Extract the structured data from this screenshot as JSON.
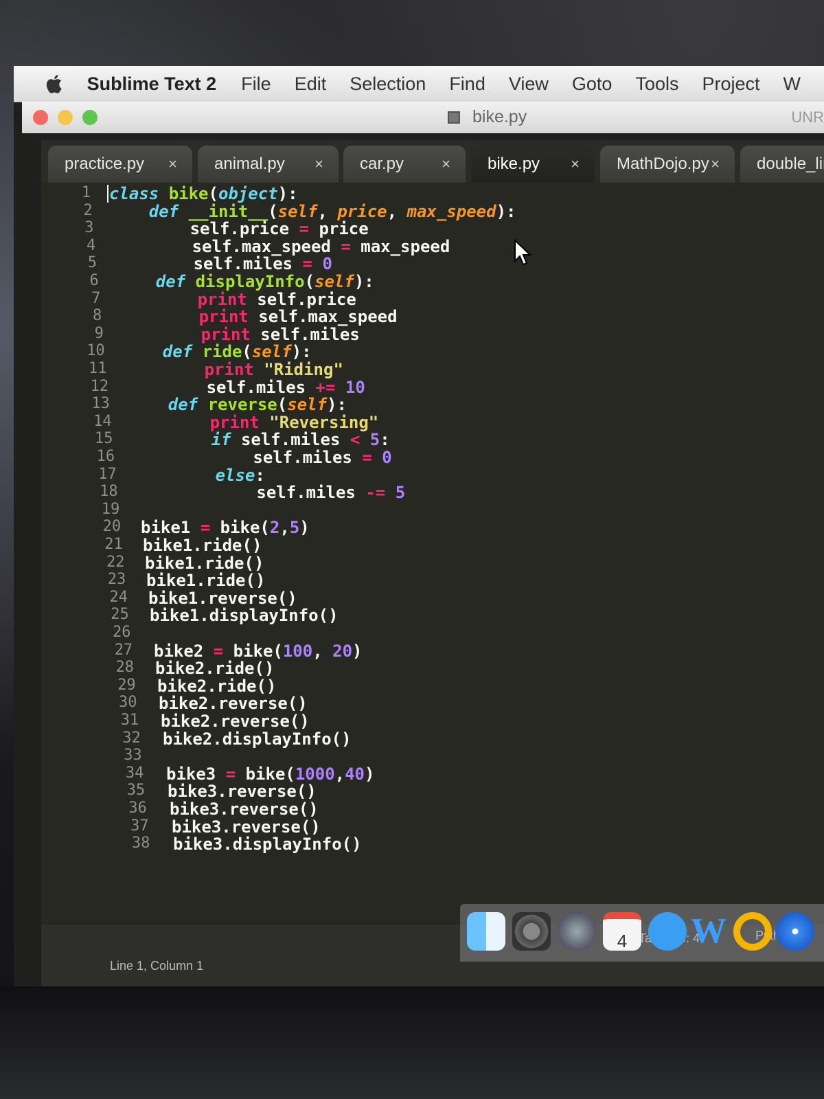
{
  "menubar": {
    "app_name": "Sublime Text 2",
    "items": [
      "File",
      "Edit",
      "Selection",
      "Find",
      "View",
      "Goto",
      "Tools",
      "Project",
      "W"
    ]
  },
  "window": {
    "title": "bike.py",
    "right_label": "UNR"
  },
  "tabs": [
    {
      "label": "practice.py",
      "active": false
    },
    {
      "label": "animal.py",
      "active": false
    },
    {
      "label": "car.py",
      "active": false
    },
    {
      "label": "bike.py",
      "active": true
    },
    {
      "label": "MathDojo.py",
      "active": false
    },
    {
      "label": "double_lin",
      "active": false
    }
  ],
  "tab_close_glyph": "×",
  "code": {
    "line_numbers": [
      "1",
      "2",
      "3",
      "4",
      "5",
      "6",
      "7",
      "8",
      "9",
      "10",
      "11",
      "12",
      "13",
      "14",
      "15",
      "16",
      "17",
      "18",
      "19",
      "20",
      "21",
      "22",
      "23",
      "24",
      "25",
      "26",
      "27",
      "28",
      "29",
      "30",
      "31",
      "32",
      "33",
      "34",
      "35",
      "36",
      "37",
      "38"
    ],
    "lines": [
      "class bike(object):",
      "    def __init__(self, price, max_speed):",
      "        self.price = price",
      "        self.max_speed = max_speed",
      "        self.miles = 0",
      "    def displayInfo(self):",
      "        print self.price",
      "        print self.max_speed",
      "        print self.miles",
      "    def ride(self):",
      "        print \"Riding\"",
      "        self.miles += 10",
      "    def reverse(self):",
      "        print \"Reversing\"",
      "        if self.miles < 5:",
      "            self.miles = 0",
      "        else:",
      "            self.miles -= 5",
      "",
      "bike1 = bike(2,5)",
      "bike1.ride()",
      "bike1.ride()",
      "bike1.ride()",
      "bike1.reverse()",
      "bike1.displayInfo()",
      "",
      "bike2 = bike(100, 20)",
      "bike2.ride()",
      "bike2.ride()",
      "bike2.reverse()",
      "bike2.reverse()",
      "bike2.displayInfo()",
      "",
      "bike3 = bike(1000,40)",
      "bike3.reverse()",
      "bike3.reverse()",
      "bike3.reverse()",
      "bike3.displayInfo()"
    ]
  },
  "status": {
    "position": "Line 1, Column 1",
    "tab_size": "Tab Size: 4",
    "syntax": "Python"
  },
  "dock": {
    "calendar_day": "4",
    "icons": [
      "finder-icon",
      "system-preferences-icon",
      "launchpad-icon",
      "calendar-icon",
      "messages-icon",
      "word-icon",
      "outlook-icon",
      "safari-icon"
    ]
  },
  "colors": {
    "keyword": "#66d9ef",
    "function": "#a6e22e",
    "param": "#fd971f",
    "operator": "#f92672",
    "number": "#ae81ff",
    "string": "#e6db74",
    "background": "#272822"
  }
}
